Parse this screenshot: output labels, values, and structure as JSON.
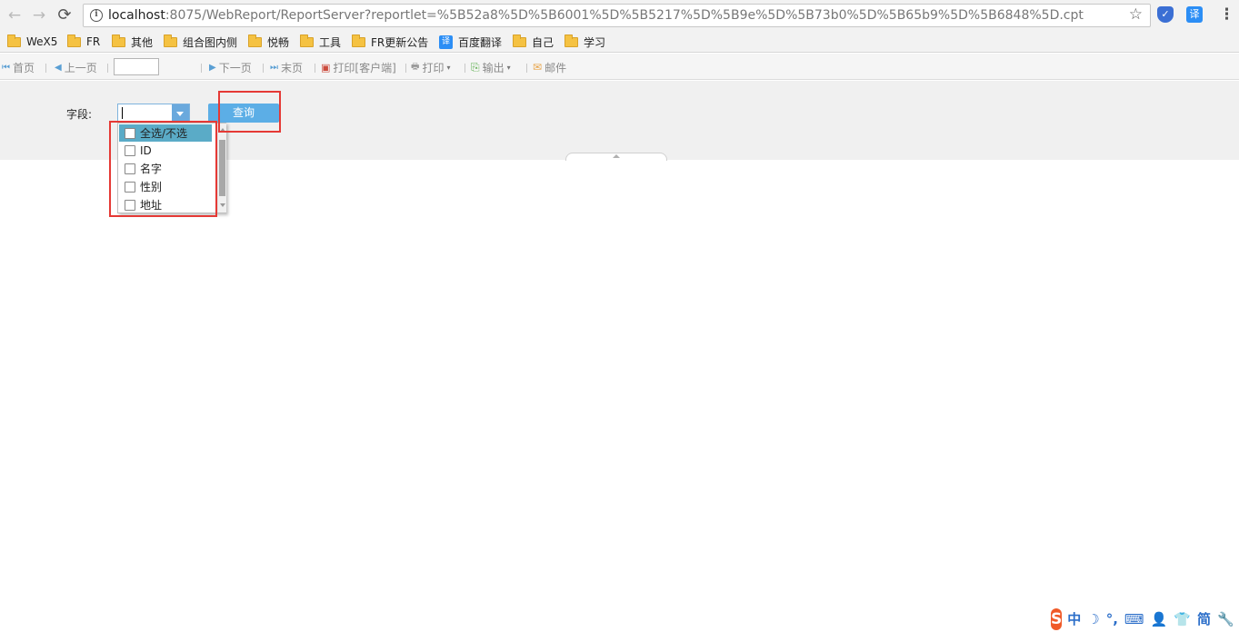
{
  "browser": {
    "url_host": "localhost",
    "url_rest": ":8075/WebReport/ReportServer?reportlet=%5B52a8%5D%5B6001%5D%5B5217%5D%5B9e%5D%5B73b0%5D%5B65b9%5D%5B6848%5D.cpt",
    "icons": {
      "back": "←",
      "forward": "→",
      "reload": "⟳",
      "info": "i",
      "star": "☆",
      "menu": "⋮",
      "translate": "译",
      "shield": "✓"
    }
  },
  "bookmarks": [
    {
      "label": "WeX5",
      "icon": "folder-icon"
    },
    {
      "label": "FR",
      "icon": "folder-icon"
    },
    {
      "label": "其他",
      "icon": "folder-icon"
    },
    {
      "label": "组合图内侧",
      "icon": "folder-icon"
    },
    {
      "label": "悦畅",
      "icon": "folder-icon"
    },
    {
      "label": "工具",
      "icon": "folder-icon"
    },
    {
      "label": "FR更新公告",
      "icon": "folder-icon"
    },
    {
      "label": "百度翻译",
      "icon": "translate-icon"
    },
    {
      "label": "自己",
      "icon": "folder-icon"
    },
    {
      "label": "学习",
      "icon": "folder-icon"
    }
  ],
  "toolbar": {
    "first": "首页",
    "prev": "上一页",
    "page_value": "",
    "next": "下一页",
    "last": "末页",
    "print_client": "打印[客户端]",
    "print": "打印",
    "export": "输出",
    "email": "邮件",
    "icons": {
      "first": "⏮",
      "prev": "◀",
      "next": "▶",
      "last": "⏭",
      "print_client": "▣",
      "print": "🖶",
      "export": "⎘",
      "email": "✉",
      "dropdown": "▾"
    }
  },
  "params": {
    "field_label": "字段:",
    "combo_value": "",
    "query_button": "查询"
  },
  "dropdown": {
    "items": [
      {
        "label": "全选/不选",
        "checked": false,
        "highlighted": true
      },
      {
        "label": "ID",
        "checked": false,
        "highlighted": false
      },
      {
        "label": "名字",
        "checked": false,
        "highlighted": false
      },
      {
        "label": "性别",
        "checked": false,
        "highlighted": false
      },
      {
        "label": "地址",
        "checked": false,
        "highlighted": false
      }
    ]
  },
  "ime": {
    "logo": "S",
    "mode": "中",
    "moon": "☽",
    "punct": "°,",
    "keyboard": "⌨",
    "user": "👤",
    "shirt": "👕",
    "variant": "简",
    "tools": "🔧"
  },
  "colors": {
    "highlight_box": "#e53935",
    "query_button": "#5caee6",
    "selected_row": "#5aabc7"
  }
}
